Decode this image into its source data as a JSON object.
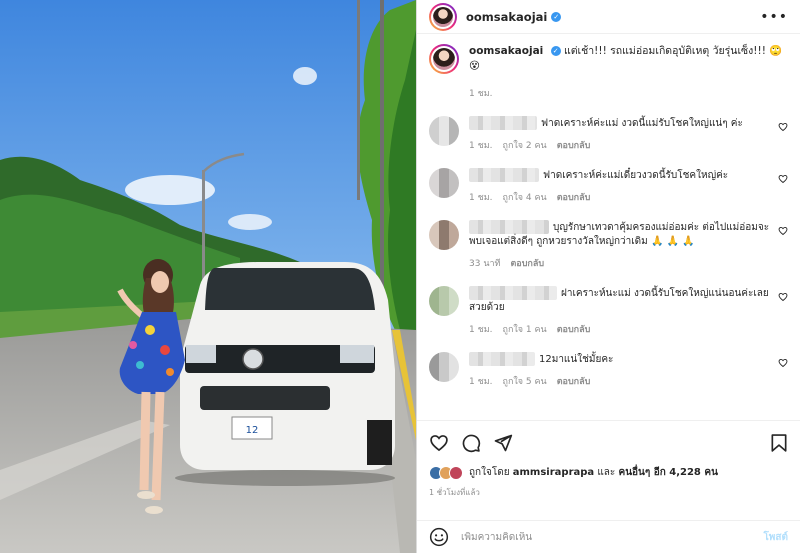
{
  "post": {
    "username": "oomsakaojai",
    "caption": "แต่เช้า!!! รถแม่อ่อมเกิดอุบัติเหตุ วัยรุ่นเซ็ง!!! 🙄😵",
    "caption_time": "1 ชม.",
    "photo": {
      "plate_number": "12"
    }
  },
  "comments": [
    {
      "text": "ฟาดเคราะห์ค่ะแม่ งวดนี้แม่รับโชคใหญ่แน่ๆ ค่ะ",
      "time": "1 ชม.",
      "likes": "ถูกใจ 2 คน",
      "reply": "ตอบกลับ",
      "colors": [
        "#cfcfcf",
        "#b5b5b5",
        "#e6e6e6"
      ]
    },
    {
      "text": "ฟาดเคราะห์ค่ะแม่เดี๋ยวงวดนี้รับโชคใหญ่ค่ะ",
      "time": "1 ชม.",
      "likes": "ถูกใจ 4 คน",
      "reply": "ตอบกลับ",
      "colors": [
        "#a7a4a4",
        "#d9d6d6",
        "#c2c0c0"
      ]
    },
    {
      "text": "บุญรักษาเทวดาคุ้มครองแม่อ่อมค่ะ ต่อไปแม่อ่อมจะพบเจอแต่สิ่งดีๆ ถูกหวยรางวัลใหญ่กว่าเดิม 🙏 🙏 🙏",
      "time": "33 นาที",
      "likes": "",
      "reply": "ตอบกลับ",
      "colors": [
        "#bfa89a",
        "#8e7a6e",
        "#d8c7bb"
      ]
    },
    {
      "text": "ฝาเคราะห์นะแม่ งวดนี้รับโชคใหญ่แน่นอนค่ะเลย สวยด้วย",
      "time": "1 ชม.",
      "likes": "ถูกใจ 1 คน",
      "reply": "ตอบกลับ",
      "colors": [
        "#9fb58f",
        "#cfdcc6",
        "#b8c9ab"
      ]
    },
    {
      "text": "12มาแน่ใช่มั้ยคะ",
      "time": "1 ชม.",
      "likes": "ถูกใจ 5 คน",
      "reply": "ตอบกลับ",
      "colors": [
        "#c9c9c9",
        "#9a9a9a",
        "#e2e2e2"
      ]
    }
  ],
  "likes": {
    "prefix": "ถูกใจโดย",
    "first_user": "ammsiraprapa",
    "and": "และ",
    "others": "คนอื่นๆ อีก 4,228 คน",
    "avatar_colors": [
      "#3b6ea5",
      "#e0a15b",
      "#c0455a"
    ]
  },
  "posted_time": "1 ชั่วโมงที่แล้ว",
  "add_comment": {
    "placeholder": "เพิ่มความคิดเห็น",
    "post_label": "โพสต์"
  },
  "colors": {
    "verified": "#3897f0",
    "post_button": "#b2dffc"
  }
}
